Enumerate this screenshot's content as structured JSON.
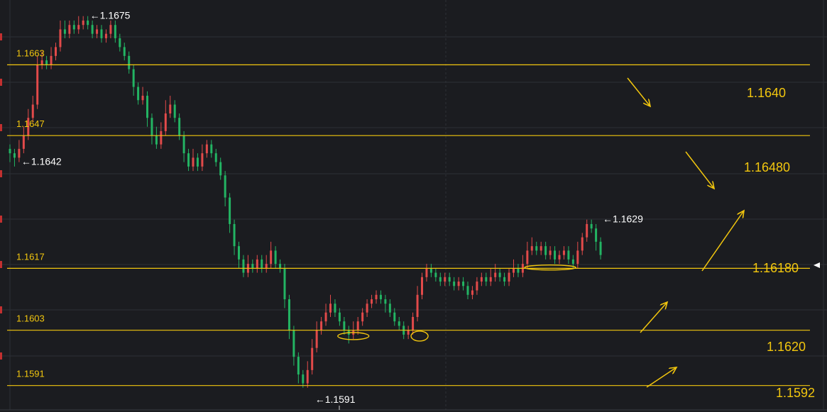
{
  "chart_data": {
    "type": "candlestick",
    "instrument_hidden": true,
    "y_range": [
      1.1586,
      1.1678
    ],
    "colors": {
      "background": "#1b1c20",
      "grid": "#2e3036",
      "up": "#e24a4a",
      "down": "#23b463",
      "level_line": "#f2c60e",
      "annotation": "#f2c60e",
      "price_marker_text": "#ffffff"
    },
    "price_markers": [
      {
        "label": "←1.1675",
        "price": 1.1675,
        "candle_index": 17
      },
      {
        "label": "←1.1642",
        "price": 1.1642,
        "candle_index": 2
      },
      {
        "label": "←1.1629",
        "price": 1.1629,
        "candle_index": 129
      },
      {
        "label": "←1.1591",
        "price": 1.1591,
        "candle_index": 66
      }
    ],
    "horizontal_levels": [
      {
        "label": "1.1663",
        "price": 1.1664
      },
      {
        "label": "1.1647",
        "price": 1.1648
      },
      {
        "label": "1.1617",
        "price": 1.1618
      },
      {
        "label": "1.1603",
        "price": 1.1604
      },
      {
        "label": "1.1591",
        "price": 1.15915
      }
    ],
    "right_annotations": [
      "1.1640",
      "1.16480",
      "1.16180",
      "1.1620",
      "1.1592"
    ],
    "arrows": [
      {
        "direction": "down",
        "from_price": 1.1653,
        "to_price": 1.1645
      },
      {
        "direction": "down",
        "from_price": 1.1638,
        "to_price": 1.1627
      },
      {
        "direction": "up",
        "from_price": 1.162,
        "to_price": 1.1633
      },
      {
        "direction": "up",
        "from_price": 1.1609,
        "to_price": 1.1616
      },
      {
        "direction": "up",
        "from_price": 1.1597,
        "to_price": 1.1602
      }
    ],
    "highlighted_zones": [
      {
        "candle_index": 75,
        "price": 1.1603
      },
      {
        "candle_index": 89,
        "price": 1.1603
      },
      {
        "candle_index": 118,
        "price": 1.16185
      }
    ],
    "candles": [
      [
        1.1645,
        1.1644,
        1.1646,
        1.1642
      ],
      [
        1.1644,
        1.1643,
        1.1645,
        1.1641
      ],
      [
        1.1643,
        1.1645,
        1.1647,
        1.1642
      ],
      [
        1.1645,
        1.1648,
        1.165,
        1.1644
      ],
      [
        1.1648,
        1.1652,
        1.1654,
        1.1647
      ],
      [
        1.1652,
        1.1655,
        1.1657,
        1.1651
      ],
      [
        1.1655,
        1.1664,
        1.1666,
        1.1654
      ],
      [
        1.1664,
        1.1665,
        1.1667,
        1.1663
      ],
      [
        1.1665,
        1.1664,
        1.1666,
        1.1663
      ],
      [
        1.1664,
        1.1666,
        1.1668,
        1.1663
      ],
      [
        1.1666,
        1.1668,
        1.1669,
        1.1665
      ],
      [
        1.1668,
        1.1672,
        1.1674,
        1.1667
      ],
      [
        1.1672,
        1.1671,
        1.1674,
        1.167
      ],
      [
        1.1671,
        1.1673,
        1.1674,
        1.167
      ],
      [
        1.1673,
        1.1672,
        1.1674,
        1.1671
      ],
      [
        1.1672,
        1.1673,
        1.1675,
        1.1671
      ],
      [
        1.1673,
        1.1674,
        1.1675,
        1.1672
      ],
      [
        1.1674,
        1.1673,
        1.1675,
        1.1672
      ],
      [
        1.1673,
        1.1671,
        1.1674,
        1.167
      ],
      [
        1.1671,
        1.1672,
        1.1673,
        1.167
      ],
      [
        1.1672,
        1.167,
        1.1673,
        1.1669
      ],
      [
        1.167,
        1.1671,
        1.1672,
        1.1669
      ],
      [
        1.1671,
        1.1673,
        1.1674,
        1.167
      ],
      [
        1.1673,
        1.167,
        1.1674,
        1.1669
      ],
      [
        1.167,
        1.1668,
        1.1671,
        1.1667
      ],
      [
        1.1668,
        1.1666,
        1.1669,
        1.1665
      ],
      [
        1.1666,
        1.1663,
        1.1667,
        1.1662
      ],
      [
        1.1663,
        1.1659,
        1.1664,
        1.1657
      ],
      [
        1.1659,
        1.1656,
        1.166,
        1.1655
      ],
      [
        1.1656,
        1.1657,
        1.1659,
        1.1655
      ],
      [
        1.1657,
        1.1652,
        1.1658,
        1.165
      ],
      [
        1.1652,
        1.1648,
        1.1653,
        1.1646
      ],
      [
        1.1648,
        1.1646,
        1.165,
        1.1645
      ],
      [
        1.1646,
        1.1649,
        1.1651,
        1.1645
      ],
      [
        1.1649,
        1.1653,
        1.1656,
        1.1648
      ],
      [
        1.1653,
        1.1655,
        1.1657,
        1.1652
      ],
      [
        1.1655,
        1.1652,
        1.1656,
        1.1651
      ],
      [
        1.1652,
        1.1648,
        1.1653,
        1.1647
      ],
      [
        1.1648,
        1.1644,
        1.1649,
        1.1642
      ],
      [
        1.1644,
        1.1641,
        1.1645,
        1.164
      ],
      [
        1.1641,
        1.1643,
        1.1645,
        1.164
      ],
      [
        1.1643,
        1.1641,
        1.1644,
        1.164
      ],
      [
        1.1641,
        1.1644,
        1.1646,
        1.164
      ],
      [
        1.1644,
        1.1646,
        1.1647,
        1.1643
      ],
      [
        1.1646,
        1.1644,
        1.1647,
        1.1643
      ],
      [
        1.1644,
        1.1642,
        1.1645,
        1.1641
      ],
      [
        1.1642,
        1.1639,
        1.1643,
        1.1638
      ],
      [
        1.1639,
        1.1634,
        1.164,
        1.1632
      ],
      [
        1.1634,
        1.1628,
        1.1635,
        1.1626
      ],
      [
        1.1628,
        1.1623,
        1.1629,
        1.1621
      ],
      [
        1.1623,
        1.162,
        1.1624,
        1.1618
      ],
      [
        1.162,
        1.1617,
        1.1621,
        1.1616
      ],
      [
        1.1617,
        1.1619,
        1.1621,
        1.1616
      ],
      [
        1.1619,
        1.1618,
        1.162,
        1.1617
      ],
      [
        1.1618,
        1.162,
        1.1621,
        1.1617
      ],
      [
        1.162,
        1.1618,
        1.1621,
        1.1617
      ],
      [
        1.1618,
        1.1619,
        1.1621,
        1.1617
      ],
      [
        1.1619,
        1.1622,
        1.1624,
        1.1618
      ],
      [
        1.1622,
        1.1619,
        1.1623,
        1.1618
      ],
      [
        1.1619,
        1.1618,
        1.162,
        1.1617
      ],
      [
        1.1618,
        1.1611,
        1.1619,
        1.1609
      ],
      [
        1.1611,
        1.1604,
        1.1612,
        1.1602
      ],
      [
        1.1604,
        1.1598,
        1.1605,
        1.1596
      ],
      [
        1.1598,
        1.1594,
        1.1599,
        1.1592
      ],
      [
        1.1594,
        1.1592,
        1.1595,
        1.1591
      ],
      [
        1.1592,
        1.1595,
        1.1597,
        1.1591
      ],
      [
        1.1595,
        1.16,
        1.1602,
        1.1594
      ],
      [
        1.16,
        1.1604,
        1.1606,
        1.1599
      ],
      [
        1.1604,
        1.1606,
        1.1607,
        1.1603
      ],
      [
        1.1606,
        1.1608,
        1.161,
        1.1605
      ],
      [
        1.1608,
        1.161,
        1.1612,
        1.1607
      ],
      [
        1.161,
        1.1608,
        1.1611,
        1.1607
      ],
      [
        1.1608,
        1.1606,
        1.1609,
        1.1605
      ],
      [
        1.1606,
        1.1604,
        1.1607,
        1.1603
      ],
      [
        1.1604,
        1.1603,
        1.1605,
        1.1601
      ],
      [
        1.1603,
        1.1604,
        1.1606,
        1.1602
      ],
      [
        1.1604,
        1.1606,
        1.1607,
        1.1603
      ],
      [
        1.1606,
        1.1608,
        1.1609,
        1.1605
      ],
      [
        1.1608,
        1.161,
        1.1611,
        1.1607
      ],
      [
        1.161,
        1.1611,
        1.1612,
        1.1609
      ],
      [
        1.1611,
        1.1612,
        1.1613,
        1.161
      ],
      [
        1.1612,
        1.1611,
        1.1613,
        1.161
      ],
      [
        1.1611,
        1.161,
        1.1612,
        1.1608
      ],
      [
        1.161,
        1.1608,
        1.1611,
        1.1607
      ],
      [
        1.1608,
        1.1606,
        1.1609,
        1.1605
      ],
      [
        1.1606,
        1.1605,
        1.1607,
        1.1604
      ],
      [
        1.1605,
        1.1603,
        1.1606,
        1.1602
      ],
      [
        1.1603,
        1.1604,
        1.1605,
        1.1602
      ],
      [
        1.1604,
        1.1607,
        1.1608,
        1.1603
      ],
      [
        1.1607,
        1.1612,
        1.1614,
        1.1606
      ],
      [
        1.1612,
        1.1616,
        1.1617,
        1.1611
      ],
      [
        1.1616,
        1.1618,
        1.1619,
        1.1615
      ],
      [
        1.1618,
        1.1617,
        1.1619,
        1.1616
      ],
      [
        1.1617,
        1.1616,
        1.1618,
        1.1615
      ],
      [
        1.1616,
        1.1615,
        1.1617,
        1.1614
      ],
      [
        1.1615,
        1.1616,
        1.1617,
        1.1614
      ],
      [
        1.1616,
        1.1615,
        1.1617,
        1.1614
      ],
      [
        1.1615,
        1.1614,
        1.1616,
        1.1613
      ],
      [
        1.1614,
        1.1615,
        1.1616,
        1.1613
      ],
      [
        1.1615,
        1.1614,
        1.1616,
        1.1613
      ],
      [
        1.1614,
        1.1612,
        1.1615,
        1.1611
      ],
      [
        1.1612,
        1.1613,
        1.1614,
        1.1611
      ],
      [
        1.1613,
        1.1615,
        1.1616,
        1.1612
      ],
      [
        1.1615,
        1.1616,
        1.1617,
        1.1614
      ],
      [
        1.1616,
        1.1615,
        1.1617,
        1.1614
      ],
      [
        1.1615,
        1.1616,
        1.1618,
        1.1614
      ],
      [
        1.1616,
        1.1617,
        1.1619,
        1.1615
      ],
      [
        1.1617,
        1.1616,
        1.1618,
        1.1615
      ],
      [
        1.1616,
        1.1615,
        1.1617,
        1.1614
      ],
      [
        1.1615,
        1.1617,
        1.1618,
        1.1614
      ],
      [
        1.1617,
        1.1618,
        1.162,
        1.1616
      ],
      [
        1.1618,
        1.1617,
        1.1619,
        1.1616
      ],
      [
        1.1617,
        1.1619,
        1.1621,
        1.1616
      ],
      [
        1.1619,
        1.1622,
        1.1624,
        1.1618
      ],
      [
        1.1622,
        1.1623,
        1.1625,
        1.1621
      ],
      [
        1.1623,
        1.1622,
        1.1624,
        1.1621
      ],
      [
        1.1622,
        1.1623,
        1.1624,
        1.1621
      ],
      [
        1.1623,
        1.1621,
        1.1624,
        1.162
      ],
      [
        1.1621,
        1.1622,
        1.1623,
        1.162
      ],
      [
        1.1622,
        1.162,
        1.1623,
        1.1619
      ],
      [
        1.162,
        1.1621,
        1.1622,
        1.1619
      ],
      [
        1.1621,
        1.1622,
        1.1623,
        1.162
      ],
      [
        1.1622,
        1.162,
        1.1623,
        1.1619
      ],
      [
        1.162,
        1.1619,
        1.1621,
        1.1618
      ],
      [
        1.1619,
        1.1622,
        1.1624,
        1.1618
      ],
      [
        1.1622,
        1.1625,
        1.1626,
        1.1621
      ],
      [
        1.1625,
        1.1628,
        1.1629,
        1.1624
      ],
      [
        1.1628,
        1.1627,
        1.1629,
        1.1626
      ],
      [
        1.1627,
        1.1624,
        1.1628,
        1.1622
      ],
      [
        1.1624,
        1.1621,
        1.1625,
        1.162
      ]
    ]
  }
}
